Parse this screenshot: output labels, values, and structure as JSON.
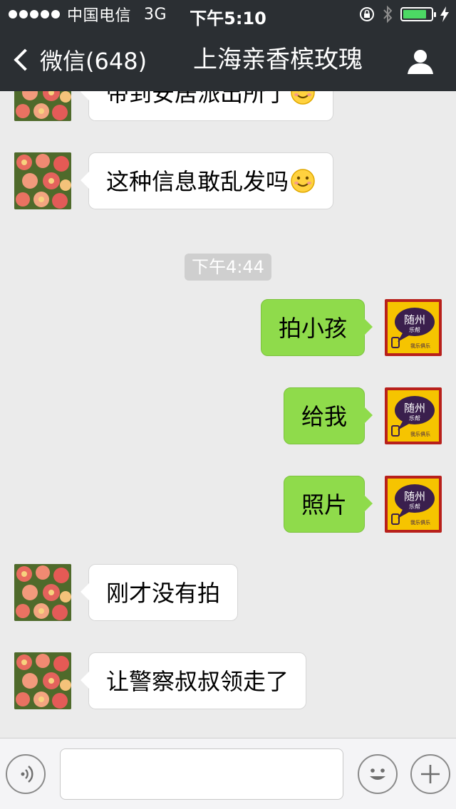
{
  "status_bar": {
    "carrier": "中国电信",
    "network": "3G",
    "time": "下午5:10",
    "battery_level_fraction": 0.85,
    "icons": [
      "signal-dots-icon",
      "lock-rotation-icon",
      "bluetooth-icon",
      "battery-icon",
      "charging-icon"
    ]
  },
  "nav": {
    "back_label": "微信(648)",
    "title": "上海亲香槟玫瑰",
    "icons": [
      "chevron-left-icon",
      "profile-icon"
    ]
  },
  "messages": [
    {
      "side": "in",
      "text": "带到安居派出所了",
      "emoji": "smiley-icon"
    },
    {
      "side": "in",
      "text": "这种信息敢乱发吗",
      "emoji": "smiley-icon"
    },
    {
      "timestamp": "下午4:44"
    },
    {
      "side": "out",
      "text": "拍小孩"
    },
    {
      "side": "out",
      "text": "给我"
    },
    {
      "side": "out",
      "text": "照片"
    },
    {
      "side": "in",
      "text": "刚才没有拍"
    },
    {
      "side": "in",
      "text": "让警察叔叔领走了"
    }
  ],
  "avatar_text": {
    "city": "随州",
    "sub": "乐帮",
    "footer": "我乐俱乐"
  },
  "input_bar": {
    "icons": [
      "voice-icon",
      "emoji-icon",
      "plus-icon"
    ],
    "value": ""
  },
  "colors": {
    "bar_background": "#2b2f33",
    "chat_background": "#ebebeb",
    "outgoing_bubble": "#8fdb4b",
    "incoming_bubble": "#ffffff",
    "battery_fill": "#4cd964"
  }
}
